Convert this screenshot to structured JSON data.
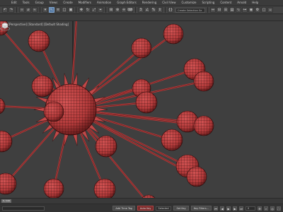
{
  "menubar": {
    "items": [
      "Edit",
      "Tools",
      "Group",
      "Views",
      "Create",
      "Modifiers",
      "Animation",
      "Graph Editors",
      "Rendering",
      "Civil View",
      "Customize",
      "Scripting",
      "Content",
      "Arnold",
      "Help"
    ]
  },
  "toolbar": {
    "selection_set_placeholder": "Create Selection Se"
  },
  "viewport": {
    "label": "[+] [Perspective] [Standard] [Default Shading]",
    "object_color": "#b23a3a",
    "line_color": "#2b0b0b",
    "background_color": "#3f3f3f"
  },
  "timeline": {
    "frame_label": "0 / 100"
  },
  "statusbar": {
    "x_value": "",
    "key_button_label": "Auto Key",
    "selected_label": "Selected",
    "set_key_label": "Set Key",
    "key_filters_label": "Key Filters...",
    "add_time_tag_label": "Add Time Tag",
    "frame_value": "0"
  }
}
